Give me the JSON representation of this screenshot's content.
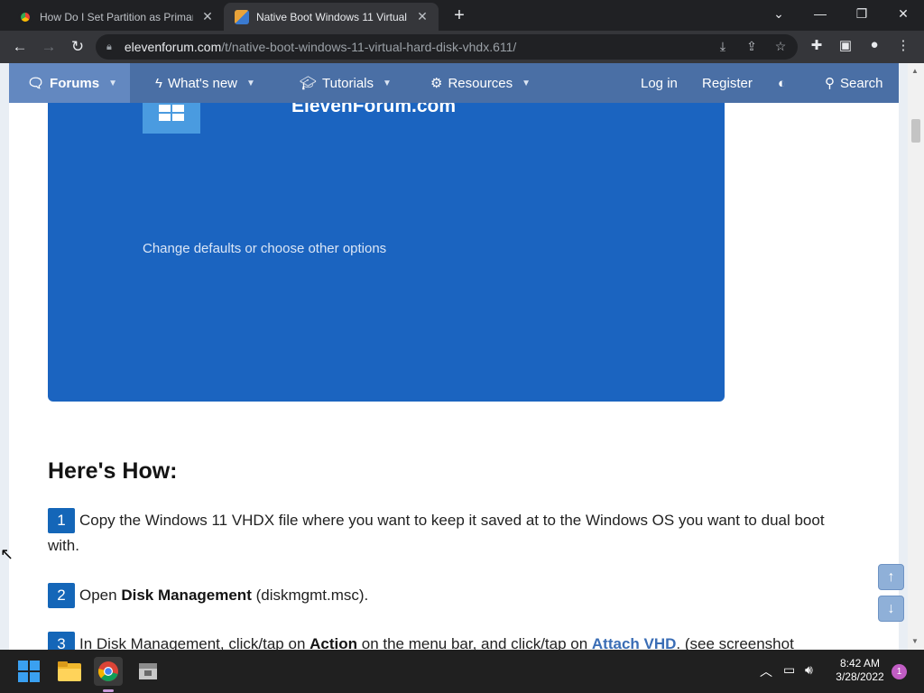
{
  "browser": {
    "tabs": [
      {
        "title": "How Do I Set Partition as Primary",
        "close": "✕"
      },
      {
        "title": "Native Boot Windows 11 Virtual",
        "close": "✕"
      }
    ],
    "new_tab": "+",
    "window_controls": {
      "dropdown": "⌄",
      "minimize": "—",
      "maximize": "❐",
      "close": "✕"
    },
    "address": {
      "host": "elevenforum.com",
      "path": "/t/native-boot-windows-11-virtual-hard-disk-vhdx.611/"
    }
  },
  "site_nav": {
    "items": [
      {
        "label": "Forums",
        "icon": "comments-icon"
      },
      {
        "label": "What's new",
        "icon": "bolt-icon"
      },
      {
        "label": "Tutorials",
        "icon": "graduation-cap-icon"
      },
      {
        "label": "Resources",
        "icon": "gear-icon"
      }
    ],
    "login": "Log in",
    "register": "Register",
    "search": "Search"
  },
  "hero": {
    "brand": "ElevenForum.com",
    "options_link": "Change defaults or choose other options",
    "background_color": "#1b64c0"
  },
  "article": {
    "heading": "Here's How:",
    "steps": [
      {
        "num": "1",
        "text": "Copy the Windows 11 VHDX file where you want to keep it saved at to the Windows OS you want to dual boot with."
      },
      {
        "num": "2",
        "pre": "Open ",
        "bold": "Disk Management",
        "post": " (diskmgmt.msc)."
      },
      {
        "num": "3",
        "pre": "In Disk Management, click/tap on ",
        "bold": "Action",
        "mid": " on the menu bar, and click/tap on ",
        "link": "Attach VHD",
        "post": ". (see screenshot"
      }
    ]
  },
  "taskbar": {
    "time": "8:42 AM",
    "date": "3/28/2022",
    "notification_count": "1"
  },
  "colors": {
    "nav_bar": "#4a6fa5",
    "step_badge": "#1466b8",
    "link": "#3a6db5"
  }
}
